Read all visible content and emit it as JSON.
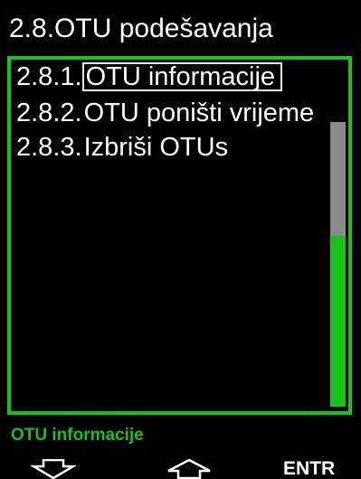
{
  "header": {
    "title": "2.8.OTU podešavanja"
  },
  "menu": {
    "items": [
      {
        "number": "2.8.1.",
        "label": "OTU informacije",
        "selected": true
      },
      {
        "number": "2.8.2.",
        "label": "OTU poništi vrijeme",
        "selected": false
      },
      {
        "number": "2.8.3.",
        "label": "Izbriši OTUs",
        "selected": false
      }
    ],
    "scroll_position": 0.0,
    "scroll_visible_fraction": 0.4
  },
  "status": {
    "text": "OTU informacije"
  },
  "softkeys": {
    "left_icon": "arrow-down-icon",
    "middle_icon": "arrow-up-icon",
    "right_label": "ENTR"
  },
  "colors": {
    "accent_green": "#19c21a",
    "scroll_thumb": "#8a8a8a",
    "background": "#000000",
    "text": "#ffffff"
  }
}
